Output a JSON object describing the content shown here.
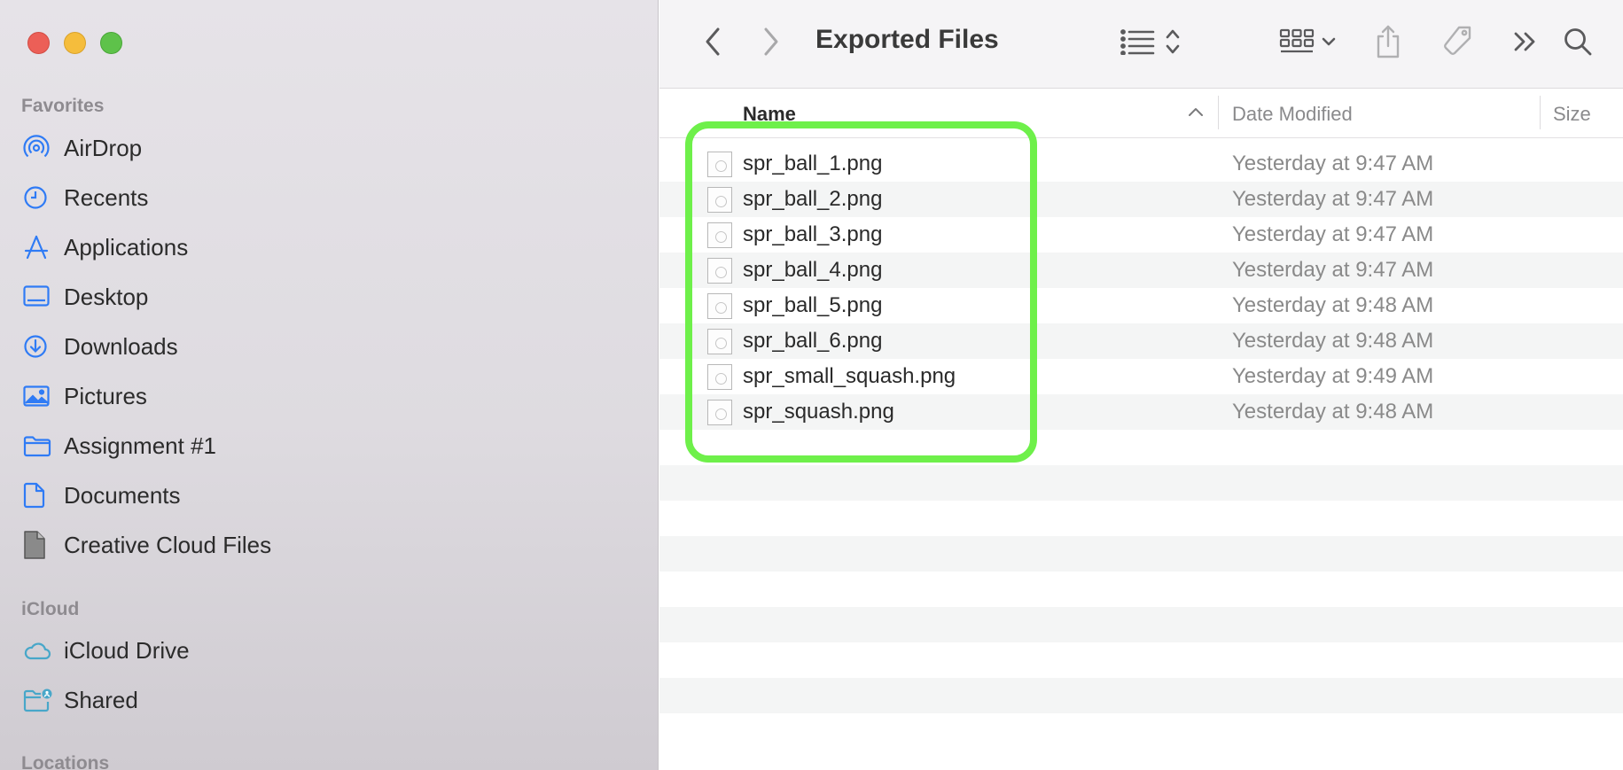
{
  "window": {
    "title": "Exported Files"
  },
  "sidebar": {
    "favorites_label": "Favorites",
    "favorites": [
      {
        "label": "AirDrop",
        "icon": "airdrop-icon"
      },
      {
        "label": "Recents",
        "icon": "clock-icon"
      },
      {
        "label": "Applications",
        "icon": "applications-icon"
      },
      {
        "label": "Desktop",
        "icon": "desktop-icon"
      },
      {
        "label": "Downloads",
        "icon": "download-icon"
      },
      {
        "label": "Pictures",
        "icon": "pictures-icon"
      },
      {
        "label": "Assignment #1",
        "icon": "folder-icon"
      },
      {
        "label": "Documents",
        "icon": "document-icon"
      },
      {
        "label": "Creative Cloud Files",
        "icon": "file-icon"
      }
    ],
    "icloud_label": "iCloud",
    "icloud": [
      {
        "label": "iCloud Drive",
        "icon": "cloud-icon"
      },
      {
        "label": "Shared",
        "icon": "shared-folder-icon"
      }
    ],
    "locations_label": "Locations"
  },
  "columns": {
    "name": "Name",
    "date_modified": "Date Modified",
    "size": "Size"
  },
  "files": [
    {
      "name": "spr_ball_1.png",
      "date": "Yesterday at 9:47 AM"
    },
    {
      "name": "spr_ball_2.png",
      "date": "Yesterday at 9:47 AM"
    },
    {
      "name": "spr_ball_3.png",
      "date": "Yesterday at 9:47 AM"
    },
    {
      "name": "spr_ball_4.png",
      "date": "Yesterday at 9:47 AM"
    },
    {
      "name": "spr_ball_5.png",
      "date": "Yesterday at 9:48 AM"
    },
    {
      "name": "spr_ball_6.png",
      "date": "Yesterday at 9:48 AM"
    },
    {
      "name": "spr_small_squash.png",
      "date": "Yesterday at 9:49 AM"
    },
    {
      "name": "spr_squash.png",
      "date": "Yesterday at 9:48 AM"
    }
  ],
  "colors": {
    "accent": "#2f7bf5",
    "highlight": "#6ef04a"
  }
}
